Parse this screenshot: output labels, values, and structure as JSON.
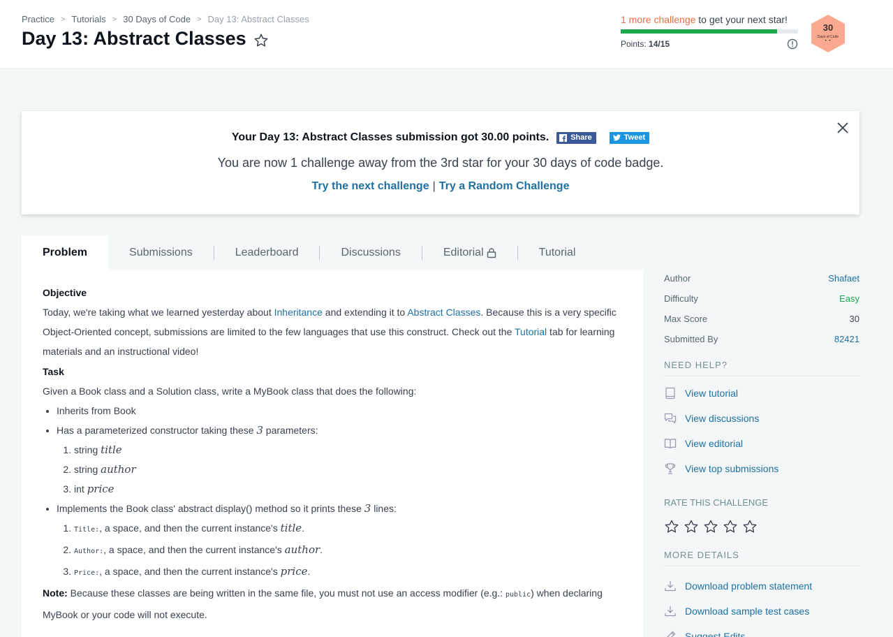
{
  "breadcrumb": {
    "items": [
      "Practice",
      "Tutorials",
      "30 Days of Code"
    ],
    "current": "Day 13: Abstract Classes",
    "sep": ">"
  },
  "page_title": "Day 13: Abstract Classes",
  "progress": {
    "highlight": "1 more challenge",
    "rest": " to get your next star!",
    "fill_fraction": 0.88,
    "points_label": "Points:",
    "points_value": "14/15",
    "fill_color": "#1ba94c"
  },
  "badge": {
    "number": "30",
    "subtitle": "Days of Code",
    "stars": "• •",
    "color": "#f9a98f"
  },
  "banner": {
    "title": "Your Day 13: Abstract Classes submission got 30.00 points.",
    "share_label": "Share",
    "tweet_label": "Tweet",
    "message": "You are now 1 challenge away from the 3rd star for your 30 days of code badge.",
    "next_link": "Try the next challenge",
    "pipe": "|",
    "random_link": "Try a Random Challenge"
  },
  "tabs": [
    "Problem",
    "Submissions",
    "Leaderboard",
    "Discussions",
    "Editorial",
    "Tutorial"
  ],
  "problem": {
    "objective_head": "Objective",
    "objective_t1": "Today, we're taking what we learned yesterday about ",
    "objective_l1": "Inheritance",
    "objective_t2": " and extending it to ",
    "objective_l2": "Abstract Classes",
    "objective_t3": ". Because this is a very specific Object-Oriented concept, submissions are limited to the few languages that use this construct. Check out the ",
    "objective_l3": "Tutorial",
    "objective_t4": " tab for learning materials and an instructional video!",
    "task_head": "Task",
    "task_intro": "Given a Book class and a Solution class, write a MyBook class that does the following:",
    "bullet1": "Inherits from Book",
    "bullet2_a": "Has a parameterized constructor taking these ",
    "bullet2_num": "3",
    "bullet2_b": " parameters:",
    "params": [
      {
        "type": "string ",
        "name": "title"
      },
      {
        "type": "string ",
        "name": "author"
      },
      {
        "type": "int ",
        "name": "price"
      }
    ],
    "bullet3_a": "Implements the Book class' abstract display() method so it prints these ",
    "bullet3_num": "3",
    "bullet3_b": " lines:",
    "lines": [
      {
        "code": "Title:",
        "text": ", a space, and then the current instance's ",
        "var": "title",
        "end": "."
      },
      {
        "code": "Author:",
        "text": ", a space, and then the current instance's ",
        "var": "author",
        "end": "."
      },
      {
        "code": "Price:",
        "text": ", a space, and then the current instance's ",
        "var": "price",
        "end": "."
      }
    ],
    "note_label": "Note:",
    "note_a": " Because these classes are being written in the same file, you must not use an access modifier (e.g.: ",
    "note_code": "public",
    "note_b": ") when declaring MyBook or your code will not execute."
  },
  "sidebar": {
    "meta": [
      {
        "label": "Author",
        "value": "Shafaet"
      },
      {
        "label": "Difficulty",
        "value": "Easy"
      },
      {
        "label": "Max Score",
        "value": "30"
      },
      {
        "label": "Submitted By",
        "value": "82421"
      }
    ],
    "need_help": "NEED HELP?",
    "help_items": [
      {
        "label": "View tutorial",
        "icon": "book-icon"
      },
      {
        "label": "View discussions",
        "icon": "discussion-icon"
      },
      {
        "label": "View editorial",
        "icon": "open-book-icon"
      },
      {
        "label": "View top submissions",
        "icon": "trophy-icon"
      }
    ],
    "rate_head": "RATE THIS CHALLENGE",
    "rating": 0,
    "more_details": "MORE DETAILS",
    "more_items": [
      {
        "label": "Download problem statement",
        "icon": "download-icon"
      },
      {
        "label": "Download sample test cases",
        "icon": "download-icon"
      },
      {
        "label": "Suggest Edits",
        "icon": "pencil-icon"
      }
    ]
  },
  "colors": {
    "link": "#1f70a1",
    "accent_orange": "#e56e44",
    "green": "#1ba94c"
  }
}
